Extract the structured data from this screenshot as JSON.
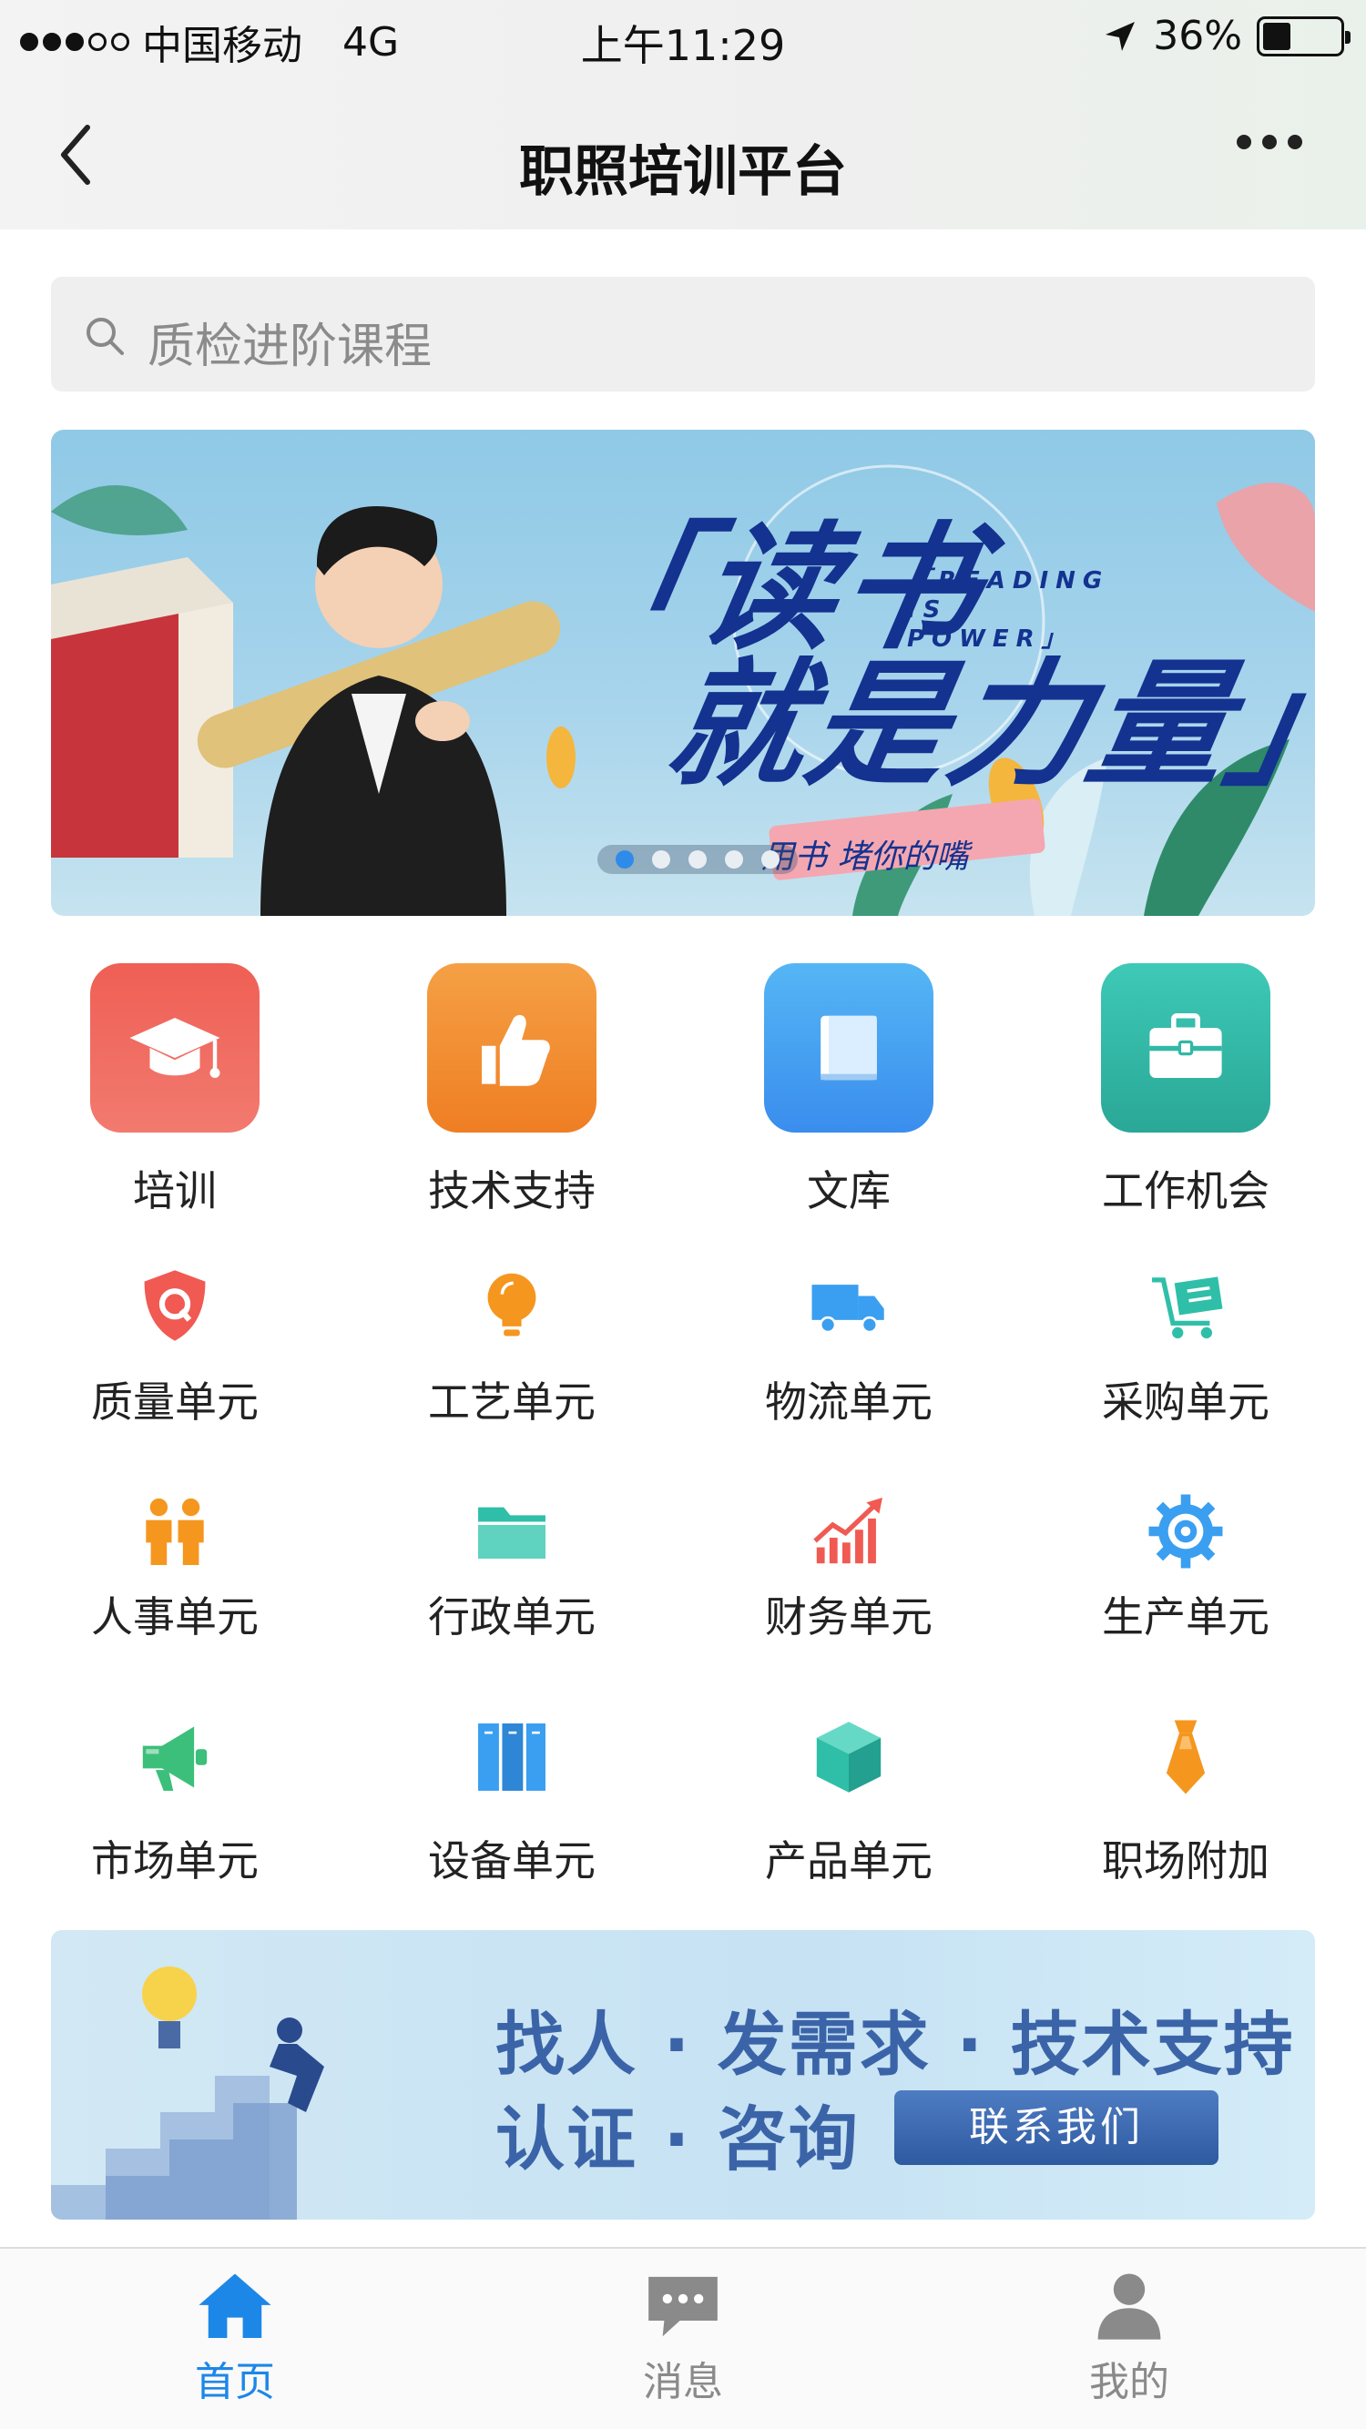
{
  "status_bar": {
    "carrier": "中国移动",
    "network": "4G",
    "time": "上午11:29",
    "battery": "36%",
    "battery_level": 0.36
  },
  "nav": {
    "title": "职照培训平台"
  },
  "search": {
    "placeholder": "质检进阶课程"
  },
  "banner": {
    "title_line1": "「读书",
    "title_line2": "就是力量」",
    "english": "「READING IS POWER」",
    "sub": "用书 堵你的嘴",
    "slide_count": 5,
    "active_slide": 1
  },
  "features": [
    {
      "label": "培训",
      "icon": "graduation-cap-icon",
      "color": "#ef5f55"
    },
    {
      "label": "技术支持",
      "icon": "thumbs-up-icon",
      "color": "#f28a2e"
    },
    {
      "label": "文库",
      "icon": "book-icon",
      "color": "#3a9ff0"
    },
    {
      "label": "工作机会",
      "icon": "briefcase-icon",
      "color": "#33b8a6"
    }
  ],
  "units": [
    {
      "label": "质量单元",
      "icon": "quality-shield-icon",
      "color": "#f05a52"
    },
    {
      "label": "工艺单元",
      "icon": "lightbulb-icon",
      "color": "#f5961f"
    },
    {
      "label": "物流单元",
      "icon": "truck-icon",
      "color": "#3a9ff0"
    },
    {
      "label": "采购单元",
      "icon": "cart-icon",
      "color": "#2fbfa8"
    },
    {
      "label": "人事单元",
      "icon": "people-icon",
      "color": "#f5961f"
    },
    {
      "label": "行政单元",
      "icon": "folder-icon",
      "color": "#2fbfa8"
    },
    {
      "label": "财务单元",
      "icon": "growth-chart-icon",
      "color": "#f05a52"
    },
    {
      "label": "生产单元",
      "icon": "gear-icon",
      "color": "#3a9ff0"
    },
    {
      "label": "市场单元",
      "icon": "megaphone-icon",
      "color": "#3cbf7a"
    },
    {
      "label": "设备单元",
      "icon": "cabinet-icon",
      "color": "#3a9ff0"
    },
    {
      "label": "产品单元",
      "icon": "cube-icon",
      "color": "#2fbfa8"
    },
    {
      "label": "职场附加",
      "icon": "tie-icon",
      "color": "#f5961f"
    }
  ],
  "promo": {
    "line1": "找人 · 发需求 · 技术支持",
    "line2": "认证 · 咨询",
    "button": "联系我们"
  },
  "tabbar": {
    "items": [
      {
        "label": "首页",
        "icon": "home-icon",
        "active": true
      },
      {
        "label": "消息",
        "icon": "message-icon",
        "active": false
      },
      {
        "label": "我的",
        "icon": "profile-icon",
        "active": false
      }
    ],
    "active_color": "#1d87e8",
    "inactive_color": "#8a8a8a"
  }
}
